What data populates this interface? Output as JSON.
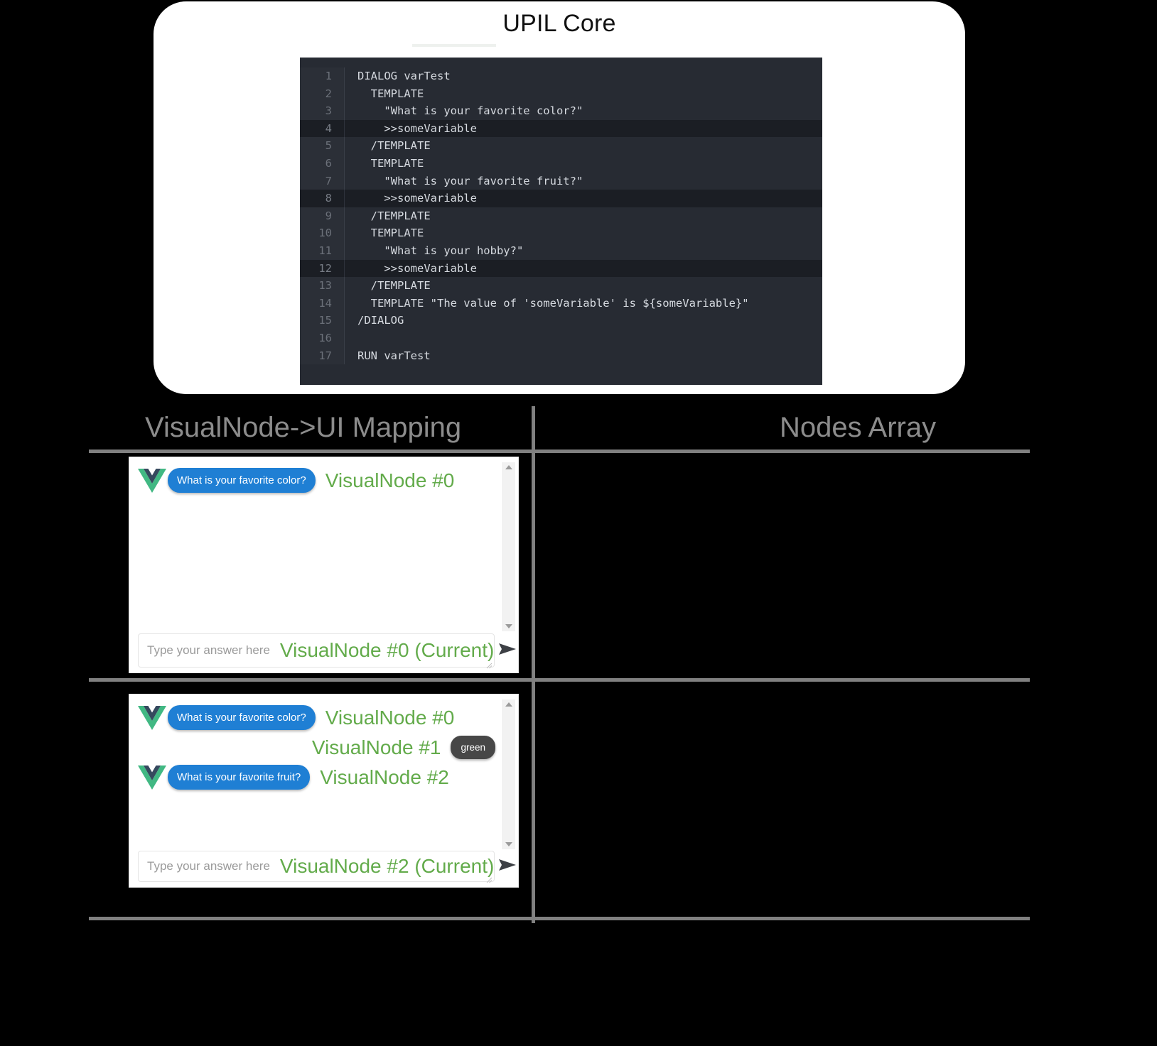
{
  "upil": {
    "title": "UPIL Core",
    "code_lines": [
      {
        "n": "1",
        "text": "DIALOG varTest",
        "highlight": false
      },
      {
        "n": "2",
        "text": "  TEMPLATE",
        "highlight": false
      },
      {
        "n": "3",
        "text": "    \"What is your favorite color?\"",
        "highlight": false
      },
      {
        "n": "4",
        "text": "    >>someVariable",
        "highlight": true
      },
      {
        "n": "5",
        "text": "  /TEMPLATE",
        "highlight": false
      },
      {
        "n": "6",
        "text": "  TEMPLATE",
        "highlight": false
      },
      {
        "n": "7",
        "text": "    \"What is your favorite fruit?\"",
        "highlight": false
      },
      {
        "n": "8",
        "text": "    >>someVariable",
        "highlight": true
      },
      {
        "n": "9",
        "text": "  /TEMPLATE",
        "highlight": false
      },
      {
        "n": "10",
        "text": "  TEMPLATE",
        "highlight": false
      },
      {
        "n": "11",
        "text": "    \"What is your hobby?\"",
        "highlight": false
      },
      {
        "n": "12",
        "text": "    >>someVariable",
        "highlight": true
      },
      {
        "n": "13",
        "text": "  /TEMPLATE",
        "highlight": false
      },
      {
        "n": "14",
        "text": "  TEMPLATE \"The value of 'someVariable' is ${someVariable}\"",
        "highlight": false
      },
      {
        "n": "15",
        "text": "/DIALOG",
        "highlight": false
      },
      {
        "n": "16",
        "text": "",
        "highlight": false
      },
      {
        "n": "17",
        "text": "RUN varTest",
        "highlight": false
      }
    ]
  },
  "columns": {
    "left_header": "VisualNode->UI Mapping",
    "right_header": "Nodes Array"
  },
  "colors": {
    "node_label_green": "#63ab4b",
    "bot_bubble_blue": "#1f7fd4",
    "user_bubble_gray": "#474747",
    "grid_gray": "#808080",
    "header_gray": "#8c8c8c",
    "editor_bg": "#272b33",
    "editor_highlight_bg": "#1b1e24"
  },
  "chat_widgets": [
    {
      "id": "chat-widget-1",
      "messages": [
        {
          "side": "bot",
          "icon": "vue-logo-icon",
          "bubble": "What is your favorite color?",
          "label": "VisualNode #0",
          "label_side": "after"
        }
      ],
      "input": {
        "placeholder": "Type your answer here",
        "label": "VisualNode #0 (Current)",
        "send_icon": "send-arrow-icon"
      },
      "scrollbar": {
        "up_icon": "scroll-up-arrow-icon",
        "down_icon": "scroll-down-arrow-icon"
      }
    },
    {
      "id": "chat-widget-2",
      "messages": [
        {
          "side": "bot",
          "icon": "vue-logo-icon",
          "bubble": "What is your favorite color?",
          "label": "VisualNode #0",
          "label_side": "after"
        },
        {
          "side": "user",
          "icon": null,
          "bubble": "green",
          "label": "VisualNode #1",
          "label_side": "before"
        },
        {
          "side": "bot",
          "icon": "vue-logo-icon",
          "bubble": "What is your favorite fruit?",
          "label": "VisualNode #2",
          "label_side": "after"
        }
      ],
      "input": {
        "placeholder": "Type your answer here",
        "label": "VisualNode #2 (Current)",
        "send_icon": "send-arrow-icon"
      },
      "scrollbar": {
        "up_icon": "scroll-up-arrow-icon",
        "down_icon": "scroll-down-arrow-icon"
      }
    }
  ]
}
